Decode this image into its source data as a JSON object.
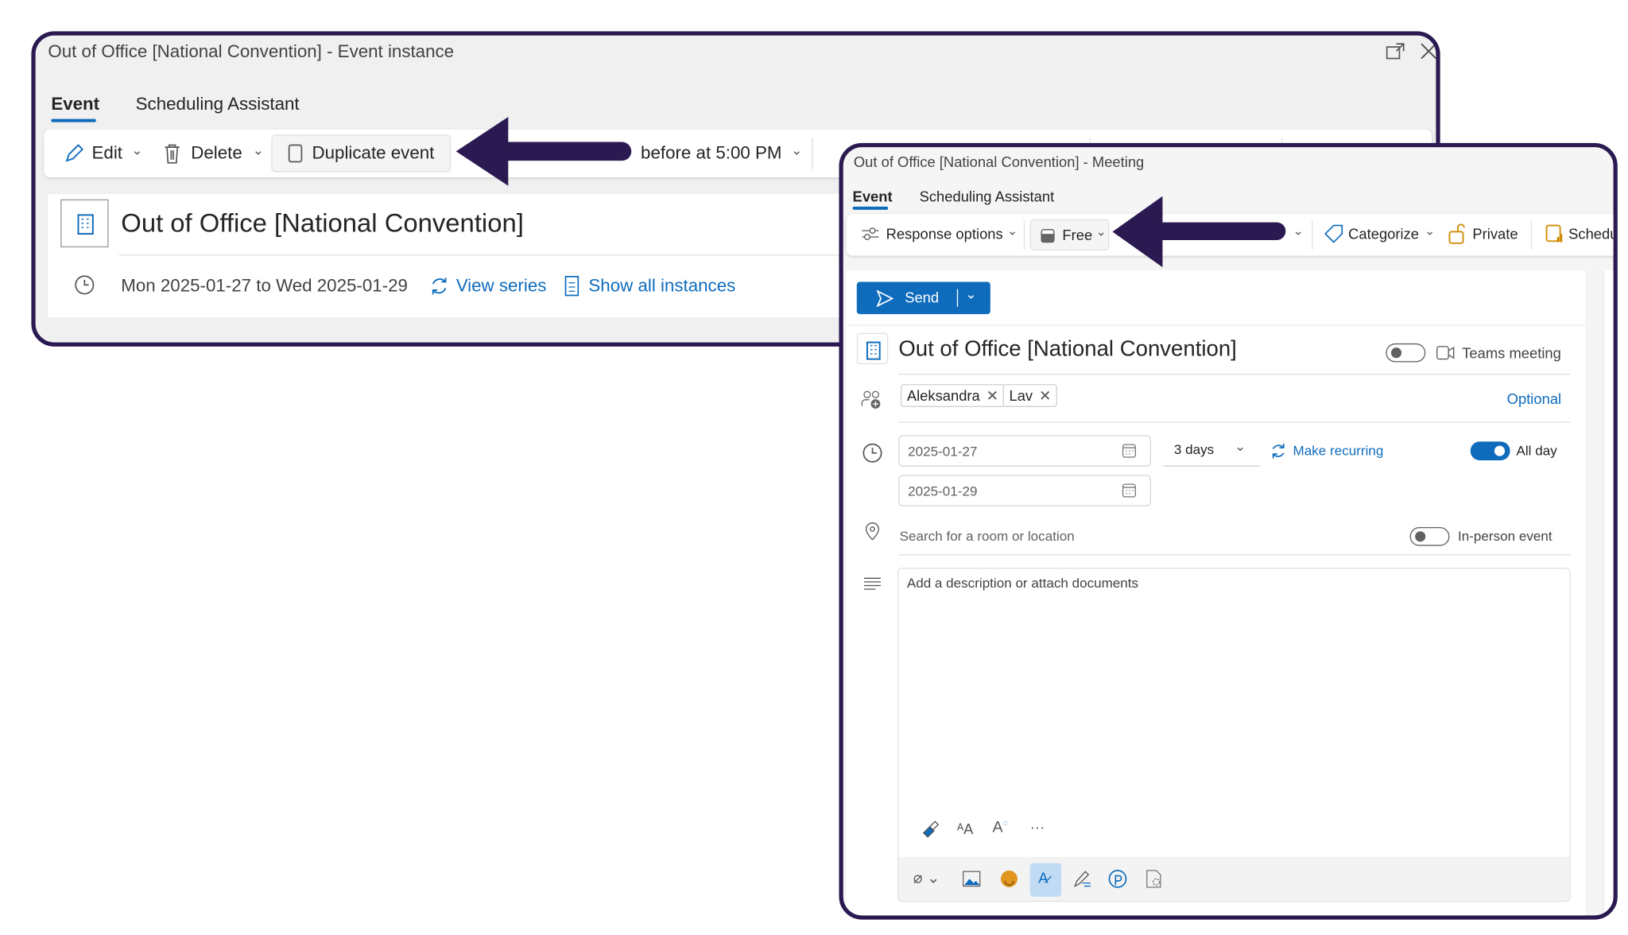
{
  "instance_window": {
    "title": "Out of Office [National Convention] - Event instance",
    "tabs": [
      {
        "label": "Event",
        "active": true
      },
      {
        "label": "Scheduling Assistant",
        "active": false
      }
    ],
    "toolbar": {
      "edit": "Edit",
      "delete": "Delete",
      "duplicate": "Duplicate event",
      "reminder": "before at 5:00 PM"
    },
    "event_title": "Out of Office [National Convention]",
    "date_range": "Mon 2025-01-27 to Wed 2025-01-29",
    "view_series": "View series",
    "show_all_instances": "Show all instances"
  },
  "meeting_window": {
    "title": "Out of Office [National Convention] - Meeting",
    "tabs": [
      {
        "label": "Event",
        "active": true
      },
      {
        "label": "Scheduling Assistant",
        "active": false
      }
    ],
    "toolbar": {
      "response_options": "Response options",
      "show_as": "Free",
      "categorize": "Categorize",
      "private": "Private",
      "schedule": "Schedu"
    },
    "send": "Send",
    "event_title": "Out of Office [National Convention]",
    "teams_meeting": {
      "label": "Teams meeting",
      "on": false
    },
    "attendees": [
      "Aleksandra",
      "Lav"
    ],
    "optional": "Optional",
    "start_date": "2025-01-27",
    "end_date": "2025-01-29",
    "duration": "3 days",
    "make_recurring": "Make recurring",
    "all_day": {
      "label": "All day",
      "on": true
    },
    "location_placeholder": "Search for a room or location",
    "in_person": {
      "label": "In-person event",
      "on": false
    },
    "description_placeholder": "Add a description or attach documents",
    "more": "···"
  },
  "colors": {
    "accent": "#0f6cbd",
    "annotation_arrow": "#2b1a52",
    "frame": "#2b1a52"
  }
}
